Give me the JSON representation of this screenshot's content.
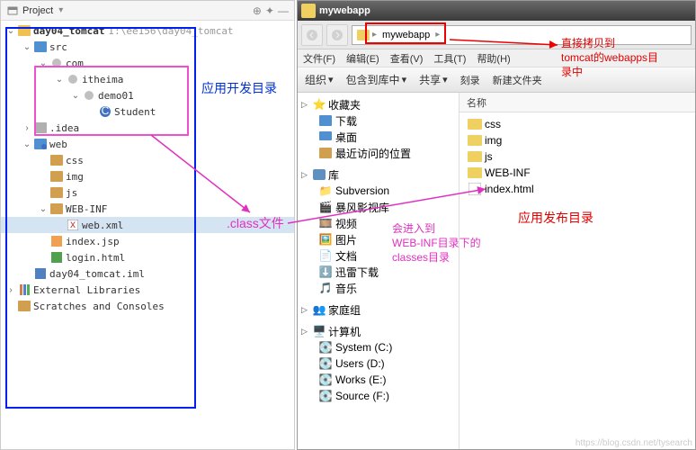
{
  "ide": {
    "tab_title": "Project",
    "project_root": "day04_tomcat",
    "project_path": "I:\\ee156\\day04_tomcat",
    "tree": {
      "src": "src",
      "com": "com",
      "itheima": "itheima",
      "demo01": "demo01",
      "student": "Student",
      "idea_dir": ".idea",
      "web": "web",
      "css": "css",
      "img": "img",
      "js": "js",
      "webinf": "WEB-INF",
      "webxml": "web.xml",
      "indexjsp": "index.jsp",
      "loginhtml": "login.html",
      "iml": "day04_tomcat.iml",
      "ext_libs": "External Libraries",
      "scratches": "Scratches and Consoles"
    }
  },
  "explorer": {
    "title": "mywebapp",
    "breadcrumb": "mywebapp",
    "menu": {
      "file": "文件(F)",
      "edit": "编辑(E)",
      "view": "查看(V)",
      "tools": "工具(T)",
      "help": "帮助(H)"
    },
    "toolbar": {
      "organize": "组织",
      "include": "包含到库中",
      "share": "共享",
      "burn": "刻录",
      "newfolder": "新建文件夹"
    },
    "nav": {
      "favorites": "收藏夹",
      "downloads": "下载",
      "desktop": "桌面",
      "recent": "最近访问的位置",
      "libraries": "库",
      "subversion": "Subversion",
      "baofeng": "暴风影视库",
      "videos": "视频",
      "pictures": "图片",
      "documents": "文档",
      "xunlei": "迅雷下载",
      "music": "音乐",
      "homegroup": "家庭组",
      "computer": "计算机",
      "system_c": "System (C:)",
      "users_d": "Users (D:)",
      "works_e": "Works (E:)",
      "source_f": "Source (F:)"
    },
    "files": {
      "header_name": "名称",
      "css": "css",
      "img": "img",
      "js": "js",
      "webinf": "WEB-INF",
      "indexhtml": "index.html"
    }
  },
  "annotations": {
    "dev_dir": "应用开发目录",
    "class_file": ".class文件",
    "enter1": "会进入到",
    "enter2": "WEB-INF目录下的",
    "enter3": "classes目录",
    "copy1": "直接拷贝到",
    "copy2": "tomcat的webapps目",
    "copy3": "录中",
    "deploy_dir": "应用发布目录"
  },
  "watermark": "https://blog.csdn.net/tysearch"
}
